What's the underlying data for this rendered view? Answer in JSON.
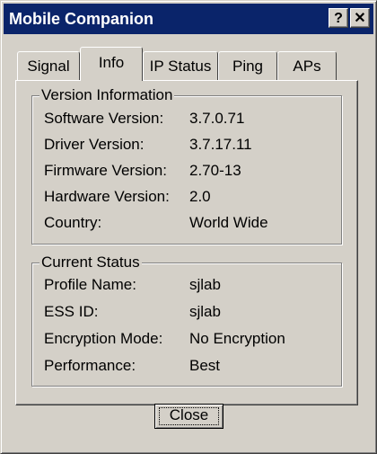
{
  "window": {
    "title": "Mobile Companion",
    "help_symbol": "?",
    "close_symbol": "✕"
  },
  "tabs": [
    "Signal",
    "Info",
    "IP Status",
    "Ping",
    "APs"
  ],
  "selected_tab": "Info",
  "version_info": {
    "title": "Version Information",
    "rows": [
      {
        "label": "Software Version:",
        "value": "3.7.0.71"
      },
      {
        "label": "Driver Version:",
        "value": "3.7.17.11"
      },
      {
        "label": "Firmware Version:",
        "value": "2.70-13"
      },
      {
        "label": "Hardware Version:",
        "value": "2.0"
      },
      {
        "label": "Country:",
        "value": "World Wide"
      }
    ]
  },
  "current_status": {
    "title": "Current Status",
    "rows": [
      {
        "label": "Profile Name:",
        "value": "sjlab"
      },
      {
        "label": "ESS ID:",
        "value": "sjlab"
      },
      {
        "label": "Encryption Mode:",
        "value": "No Encryption"
      },
      {
        "label": "Performance:",
        "value": "Best"
      }
    ]
  },
  "buttons": {
    "close_label": "Close"
  },
  "colors": {
    "titlebar": "#0a246a",
    "face": "#d4d0c8"
  }
}
